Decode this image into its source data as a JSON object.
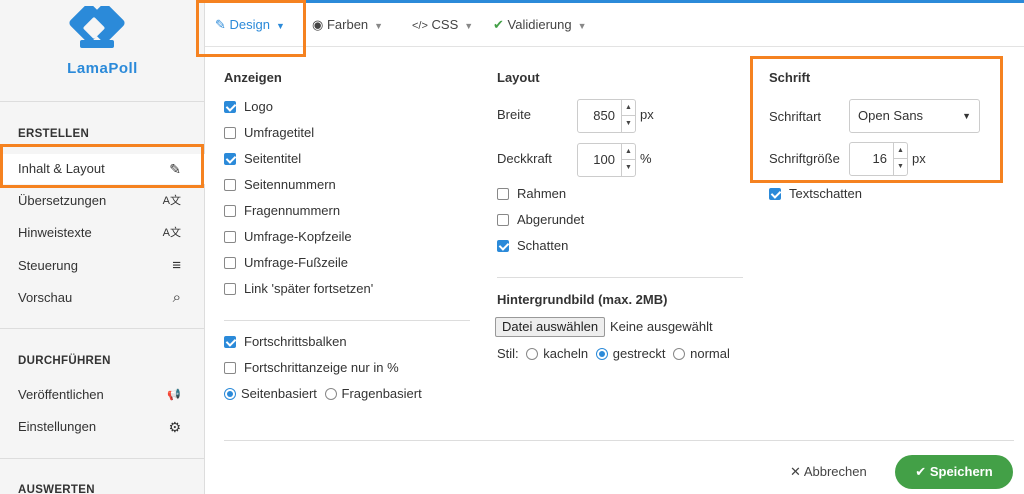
{
  "brand": {
    "name": "LamaPoll"
  },
  "sidebar": {
    "sections": [
      {
        "title": "ERSTELLEN"
      },
      {
        "title": "DURCHFÜHREN"
      },
      {
        "title": "AUSWERTEN"
      }
    ],
    "items": [
      {
        "label": "Inhalt & Layout",
        "icon": "✎"
      },
      {
        "label": "Übersetzungen",
        "icon": "A文"
      },
      {
        "label": "Hinweistexte",
        "icon": "A文"
      },
      {
        "label": "Steuerung",
        "icon": "≡"
      },
      {
        "label": "Vorschau",
        "icon": "⌕"
      },
      {
        "label": "Veröffentlichen",
        "icon": "📢"
      },
      {
        "label": "Einstellungen",
        "icon": "⚙"
      }
    ]
  },
  "tabs": [
    {
      "label": "Design",
      "icon": "✎"
    },
    {
      "label": "Farben",
      "icon": "◉"
    },
    {
      "label": "CSS",
      "icon": "</>"
    },
    {
      "label": "Validierung",
      "icon": "✔"
    }
  ],
  "anzeigen": {
    "title": "Anzeigen",
    "options": [
      {
        "label": "Logo",
        "checked": true
      },
      {
        "label": "Umfragetitel",
        "checked": false
      },
      {
        "label": "Seitentitel",
        "checked": true
      },
      {
        "label": "Seitennummern",
        "checked": false
      },
      {
        "label": "Fragennummern",
        "checked": false
      },
      {
        "label": "Umfrage-Kopfzeile",
        "checked": false
      },
      {
        "label": "Umfrage-Fußzeile",
        "checked": false
      },
      {
        "label": "Link 'später fortsetzen'",
        "checked": false
      }
    ],
    "progress": [
      {
        "label": "Fortschrittsbalken",
        "checked": true
      },
      {
        "label": "Fortschrittanzeige nur in %",
        "checked": false
      }
    ],
    "progress_mode": {
      "option1": "Seitenbasiert",
      "option2": "Fragenbasiert",
      "selected": "Seitenbasiert"
    }
  },
  "layout": {
    "title": "Layout",
    "width_label": "Breite",
    "width_value": "850",
    "width_unit": "px",
    "opacity_label": "Deckkraft",
    "opacity_value": "100",
    "opacity_unit": "%",
    "options": [
      {
        "label": "Rahmen",
        "checked": false
      },
      {
        "label": "Abgerundet",
        "checked": false
      },
      {
        "label": "Schatten",
        "checked": true
      }
    ],
    "bg_title": "Hintergrundbild (max. 2MB)",
    "file_button": "Datei auswählen",
    "file_status": "Keine ausgewählt",
    "style_label": "Stil:",
    "style_options": [
      "kacheln",
      "gestreckt",
      "normal"
    ],
    "style_selected": "gestreckt"
  },
  "font": {
    "title": "Schrift",
    "family_label": "Schriftart",
    "family_value": "Open Sans",
    "size_label": "Schriftgröße",
    "size_value": "16",
    "size_unit": "px",
    "shadow_label": "Textschatten",
    "shadow_checked": true
  },
  "footer": {
    "cancel": "Abbrechen",
    "save": "Speichern"
  },
  "colors": {
    "accent": "#2b8ad9",
    "highlight": "#f58220",
    "save": "#43a047"
  }
}
